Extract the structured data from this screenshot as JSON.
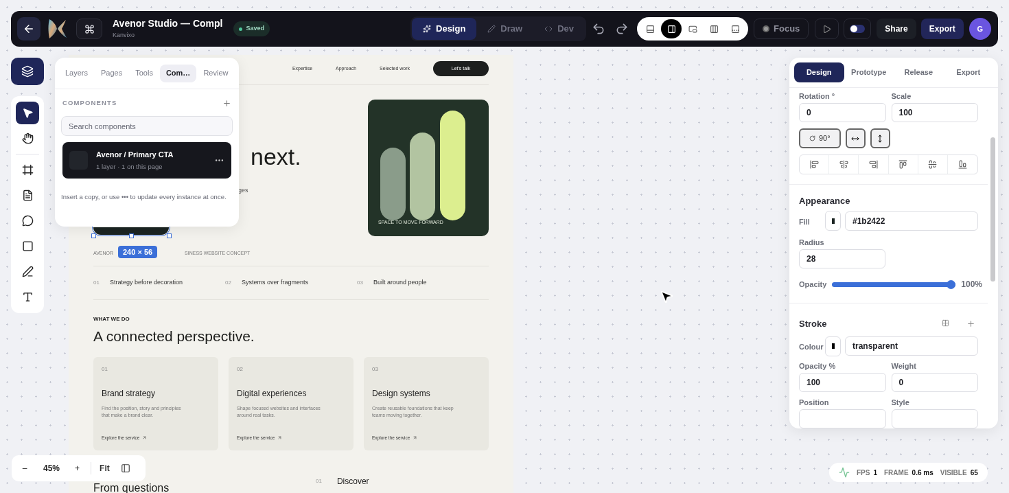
{
  "topbar": {
    "title": "Avenor Studio — Compl",
    "subtitle": "Kanvixo",
    "status": "Saved",
    "modes": [
      {
        "label": "Design",
        "selected": true
      },
      {
        "label": "Draw",
        "selected": false
      },
      {
        "label": "Dev",
        "selected": false
      }
    ],
    "layouts": [
      {
        "selected": false
      },
      {
        "selected": true
      },
      {
        "selected": false
      },
      {
        "selected": false
      },
      {
        "selected": false
      }
    ],
    "focus": "Focus",
    "toggle": {
      "on": false
    },
    "share": "Share",
    "export": "Export",
    "avatar": "G"
  },
  "tools": [
    {
      "selected": true
    },
    {
      "selected": false
    },
    {
      "selected": false
    },
    {
      "selected": false
    },
    {
      "selected": false
    },
    {
      "selected": false
    },
    {
      "selected": false
    },
    {
      "selected": false
    }
  ],
  "left_panel": {
    "tabs": [
      {
        "label": "Layers",
        "selected": false
      },
      {
        "label": "Pages",
        "selected": false
      },
      {
        "label": "Tools",
        "selected": false
      },
      {
        "label": "Com…",
        "selected": true
      },
      {
        "label": "Review",
        "selected": false
      }
    ],
    "section": "COMPONENTS",
    "search_placeholder": "Search components",
    "components": [
      {
        "name": "Avenor / Primary CTA",
        "meta": "1 layer · 1 on this page"
      }
    ],
    "hint": "Insert a copy, or use ••• to update every instance at once."
  },
  "artboard": {
    "nav": [
      "Expertise",
      "Approach",
      "Selected work"
    ],
    "cta": "Let's talk",
    "heading_fragment": "next.",
    "text_fragment": "ges",
    "hero_caption": "SPACE TO MOVE FORWARD",
    "selection_size": "240 × 56",
    "caption_left": "AVENOR",
    "caption_right": "SINESS WEBSITE CONCEPT",
    "principles": [
      {
        "num": "01",
        "label": "Strategy before decoration"
      },
      {
        "num": "02",
        "label": "Systems over fragments"
      },
      {
        "num": "03",
        "label": "Built around people"
      }
    ],
    "eyebrow": "WHAT WE DO",
    "heading": "A connected perspective.",
    "cards": [
      {
        "num": "01",
        "title": "Brand strategy",
        "body": "Find the position, story and principles that make a brand clear.",
        "link": "Explore the service"
      },
      {
        "num": "02",
        "title": "Digital experiences",
        "body": "Shape focused websites and interfaces around real tasks.",
        "link": "Explore the service"
      },
      {
        "num": "03",
        "title": "Design systems",
        "body": "Create reusable foundations that keep teams moving together.",
        "link": "Explore the service"
      }
    ],
    "bottom_heading": "From questions",
    "steps": [
      {
        "num": "01",
        "label": "Discover"
      }
    ]
  },
  "right_panel": {
    "tabs": [
      {
        "label": "Design",
        "selected": true
      },
      {
        "label": "Prototype",
        "selected": false
      },
      {
        "label": "Release",
        "selected": false
      },
      {
        "label": "Export",
        "selected": false
      }
    ],
    "rotation_label": "Rotation °",
    "rotation": "0",
    "scale_label": "Scale",
    "scale": "100",
    "rotate_button": "90°",
    "appearance": "Appearance",
    "fill_label": "Fill",
    "fill": "#1b2422",
    "radius_label": "Radius",
    "radius": "28",
    "opacity_label": "Opacity",
    "opacity": {
      "level": 1,
      "reading": "100%"
    },
    "stroke": "Stroke",
    "colour_label": "Colour",
    "colour": "transparent",
    "stroke_opacity_label": "Opacity %",
    "stroke_opacity": "100",
    "weight_label": "Weight",
    "weight": "0",
    "position_label": "Position",
    "style_label": "Style"
  },
  "zoom": {
    "minus": "–",
    "value": "45%",
    "plus": "+",
    "fit": "Fit"
  },
  "stats": [
    {
      "label": "FPS",
      "value": "1"
    },
    {
      "label": "FRAME",
      "value": "0.6 ms"
    },
    {
      "label": "VISIBLE",
      "value": "65"
    }
  ]
}
